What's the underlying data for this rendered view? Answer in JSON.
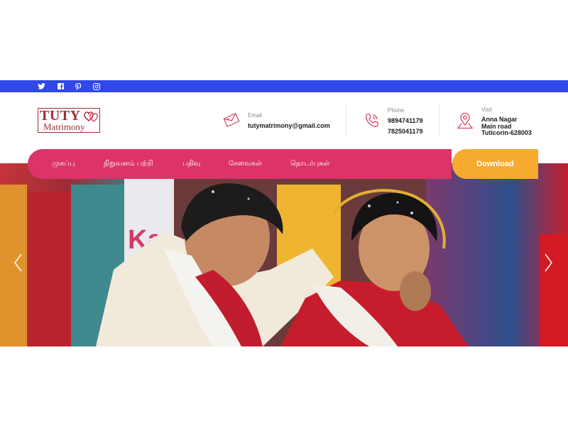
{
  "social": {
    "icons": [
      "twitter-icon",
      "facebook-icon",
      "pinterest-icon",
      "instagram-icon"
    ]
  },
  "logo": {
    "line1": "TUTY",
    "line2": "Matrimony",
    "color": "#a52a3a"
  },
  "contact": {
    "email": {
      "label": "Email",
      "value": "tutymatrimony@gmail.com",
      "icon": "envelope-icon"
    },
    "phone": {
      "label": "Phone",
      "lines": [
        "9894741179",
        "7825041179"
      ],
      "icon": "phone-icon"
    },
    "visit": {
      "label": "Visit",
      "lines": [
        "Anna Nagar",
        "Main road",
        "Tuticorin-628003"
      ],
      "icon": "location-pin-icon"
    }
  },
  "nav": {
    "items": [
      "முகப்பு",
      "நிறுவனம் பற்றி",
      "பதிவு",
      "சேவைகள்",
      "தொடர்புகள்"
    ],
    "download_label": "Download"
  },
  "colors": {
    "topbar": "#3047ea",
    "nav": "#dc3468",
    "download": "#f6ab2e",
    "accent_icon": "#e0415e"
  },
  "hero": {
    "prev_icon": "chevron-left-icon",
    "next_icon": "chevron-right-icon"
  }
}
